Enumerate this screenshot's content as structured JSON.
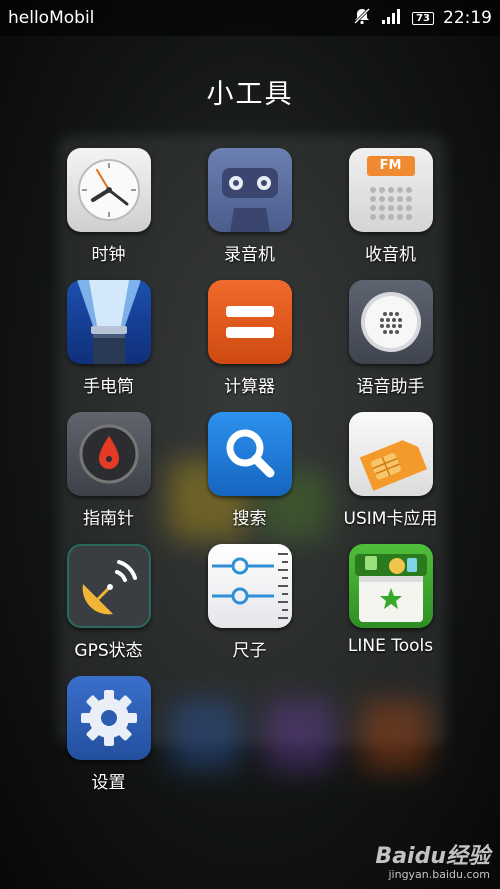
{
  "status_bar": {
    "carrier": "helloMobil",
    "battery": "73",
    "time": "22:19"
  },
  "folder": {
    "title": "小工具"
  },
  "apps": [
    {
      "label": "时钟",
      "icon": "clock-icon"
    },
    {
      "label": "录音机",
      "icon": "cassette-icon"
    },
    {
      "label": "收音机",
      "icon": "radio-icon"
    },
    {
      "label": "手电筒",
      "icon": "flashlight-icon"
    },
    {
      "label": "计算器",
      "icon": "calculator-icon"
    },
    {
      "label": "语音助手",
      "icon": "voice-assistant-icon"
    },
    {
      "label": "指南针",
      "icon": "compass-icon"
    },
    {
      "label": "搜索",
      "icon": "search-icon"
    },
    {
      "label": "USIM卡应用",
      "icon": "sim-card-icon"
    },
    {
      "label": "GPS状态",
      "icon": "gps-icon"
    },
    {
      "label": "尺子",
      "icon": "ruler-icon"
    },
    {
      "label": "LINE Tools",
      "icon": "line-tools-icon"
    },
    {
      "label": "设置",
      "icon": "gear-icon"
    }
  ],
  "radio_icon_text": "FM",
  "watermark": {
    "main": "Baidu经验",
    "sub": "jingyan.baidu.com"
  },
  "colors": {
    "calculator": "#e0561c",
    "search": "#1e7fd6",
    "settings": "#2e5fb8"
  }
}
